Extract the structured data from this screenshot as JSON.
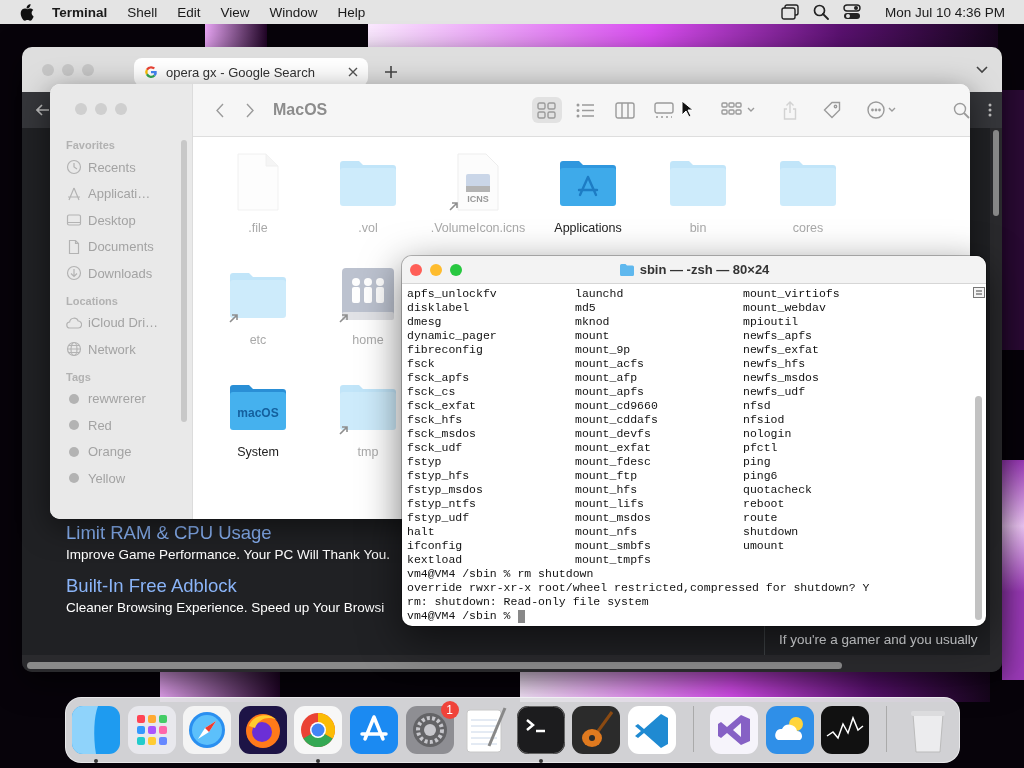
{
  "menu_bar": {
    "app_name": "Terminal",
    "menus": [
      "Shell",
      "Edit",
      "View",
      "Window",
      "Help"
    ],
    "clock": "Mon Jul 10 4:36 PM"
  },
  "browser": {
    "tabs": [
      {
        "title": "opera gx - Google Search",
        "selected": true
      }
    ],
    "features": [
      {
        "heading": "Limit RAM & CPU Usage",
        "text": "Improve Game Performance. Your PC Will Thank You."
      },
      {
        "heading": "Built-In Free Adblock",
        "text": "Cleaner Browsing Experience. Speed up Your Browsi"
      }
    ],
    "side_text": "If you're a gamer and you usually"
  },
  "finder": {
    "title": "MacOS",
    "view_buttons": [
      {
        "kind": "icons",
        "selected": true
      },
      {
        "kind": "list",
        "selected": false
      },
      {
        "kind": "columns",
        "selected": false
      },
      {
        "kind": "gallery",
        "selected": false
      }
    ],
    "sidebar": [
      {
        "heading": "Favorites",
        "items": [
          {
            "label": "Recents",
            "kind": "clock"
          },
          {
            "label": "Applicati…",
            "kind": "apps"
          },
          {
            "label": "Desktop",
            "kind": "desktop"
          },
          {
            "label": "Documents",
            "kind": "document"
          },
          {
            "label": "Downloads",
            "kind": "download"
          }
        ]
      },
      {
        "heading": "Locations",
        "items": [
          {
            "label": "iCloud Dri…",
            "kind": "cloud"
          },
          {
            "label": "Network",
            "kind": "globe"
          }
        ]
      },
      {
        "heading": "Tags",
        "items": [
          {
            "label": "rewwrerer",
            "kind": "tag"
          },
          {
            "label": "Red",
            "kind": "tag"
          },
          {
            "label": "Orange",
            "kind": "tag"
          },
          {
            "label": "Yellow",
            "kind": "tag"
          }
        ]
      }
    ],
    "file_rows": [
      [
        {
          "name": ".file",
          "kind": "document",
          "hidden": true,
          "alias": false
        },
        {
          "name": ".vol",
          "kind": "folder",
          "hidden": true,
          "alias": false
        },
        {
          "name": ".VolumeIcon.icns",
          "kind": "icns",
          "icon_text": "ICNS",
          "hidden": true,
          "alias": true
        },
        {
          "name": "Applications",
          "kind": "apps-folder",
          "hidden": false,
          "alias": false
        },
        {
          "name": "bin",
          "kind": "folder",
          "hidden": true,
          "alias": false
        },
        {
          "name": "cores",
          "kind": "folder",
          "hidden": true,
          "alias": false
        }
      ],
      [
        {
          "name": "etc",
          "kind": "folder",
          "hidden": true,
          "alias": true
        },
        {
          "name": "home",
          "kind": "users-drive",
          "hidden": true,
          "alias": true
        }
      ],
      [
        {
          "name": "System",
          "kind": "system-folder",
          "icon_text": "macOS",
          "hidden": false,
          "alias": false
        },
        {
          "name": "tmp",
          "kind": "folder",
          "hidden": true,
          "alias": true
        }
      ]
    ]
  },
  "terminal": {
    "title": "sbin — -zsh — 80×24",
    "listing": [
      [
        "apfs_unlockfv",
        "launchd",
        "mount_virtiofs"
      ],
      [
        "disklabel",
        "md5",
        "mount_webdav"
      ],
      [
        "dmesg",
        "mknod",
        "mpioutil"
      ],
      [
        "dynamic_pager",
        "mount",
        "newfs_apfs"
      ],
      [
        "fibreconfig",
        "mount_9p",
        "newfs_exfat"
      ],
      [
        "fsck",
        "mount_acfs",
        "newfs_hfs"
      ],
      [
        "fsck_apfs",
        "mount_afp",
        "newfs_msdos"
      ],
      [
        "fsck_cs",
        "mount_apfs",
        "newfs_udf"
      ],
      [
        "fsck_exfat",
        "mount_cd9660",
        "nfsd"
      ],
      [
        "fsck_hfs",
        "mount_cddafs",
        "nfsiod"
      ],
      [
        "fsck_msdos",
        "mount_devfs",
        "nologin"
      ],
      [
        "fsck_udf",
        "mount_exfat",
        "pfctl"
      ],
      [
        "fstyp",
        "mount_fdesc",
        "ping"
      ],
      [
        "fstyp_hfs",
        "mount_ftp",
        "ping6"
      ],
      [
        "fstyp_msdos",
        "mount_hfs",
        "quotacheck"
      ],
      [
        "fstyp_ntfs",
        "mount_lifs",
        "reboot"
      ],
      [
        "fstyp_udf",
        "mount_msdos",
        "route"
      ],
      [
        "halt",
        "mount_nfs",
        "shutdown"
      ],
      [
        "ifconfig",
        "mount_smbfs",
        "umount"
      ],
      [
        "kextload",
        "mount_tmpfs"
      ]
    ],
    "lines": [
      {
        "text": "vm4@VM4 /sbin % rm shutdown",
        "cursor": false
      },
      {
        "text": "override rwxr-xr-x root/wheel restricted,compressed for shutdown? Y",
        "cursor": false
      },
      {
        "text": "rm: shutdown: Read-only file system",
        "cursor": false
      },
      {
        "text": "vm4@VM4 /sbin %",
        "cursor": true
      }
    ]
  },
  "dock": {
    "items": [
      {
        "kind": "finder",
        "running": true
      },
      {
        "kind": "launchpad",
        "running": false
      },
      {
        "kind": "safari",
        "running": false
      },
      {
        "kind": "firefox",
        "running": false
      },
      {
        "kind": "chrome",
        "running": true
      },
      {
        "kind": "appstore",
        "running": false
      },
      {
        "kind": "settings",
        "running": false,
        "badge": "1"
      },
      {
        "kind": "textedit",
        "running": false
      },
      {
        "kind": "terminal",
        "running": true
      },
      {
        "kind": "garageband",
        "running": false
      },
      {
        "kind": "vscode",
        "running": false
      },
      {
        "kind": "divider"
      },
      {
        "kind": "visualstudio",
        "running": false
      },
      {
        "kind": "weather",
        "running": false
      },
      {
        "kind": "stocks",
        "running": false
      },
      {
        "kind": "divider"
      },
      {
        "kind": "trash",
        "running": false
      }
    ]
  }
}
